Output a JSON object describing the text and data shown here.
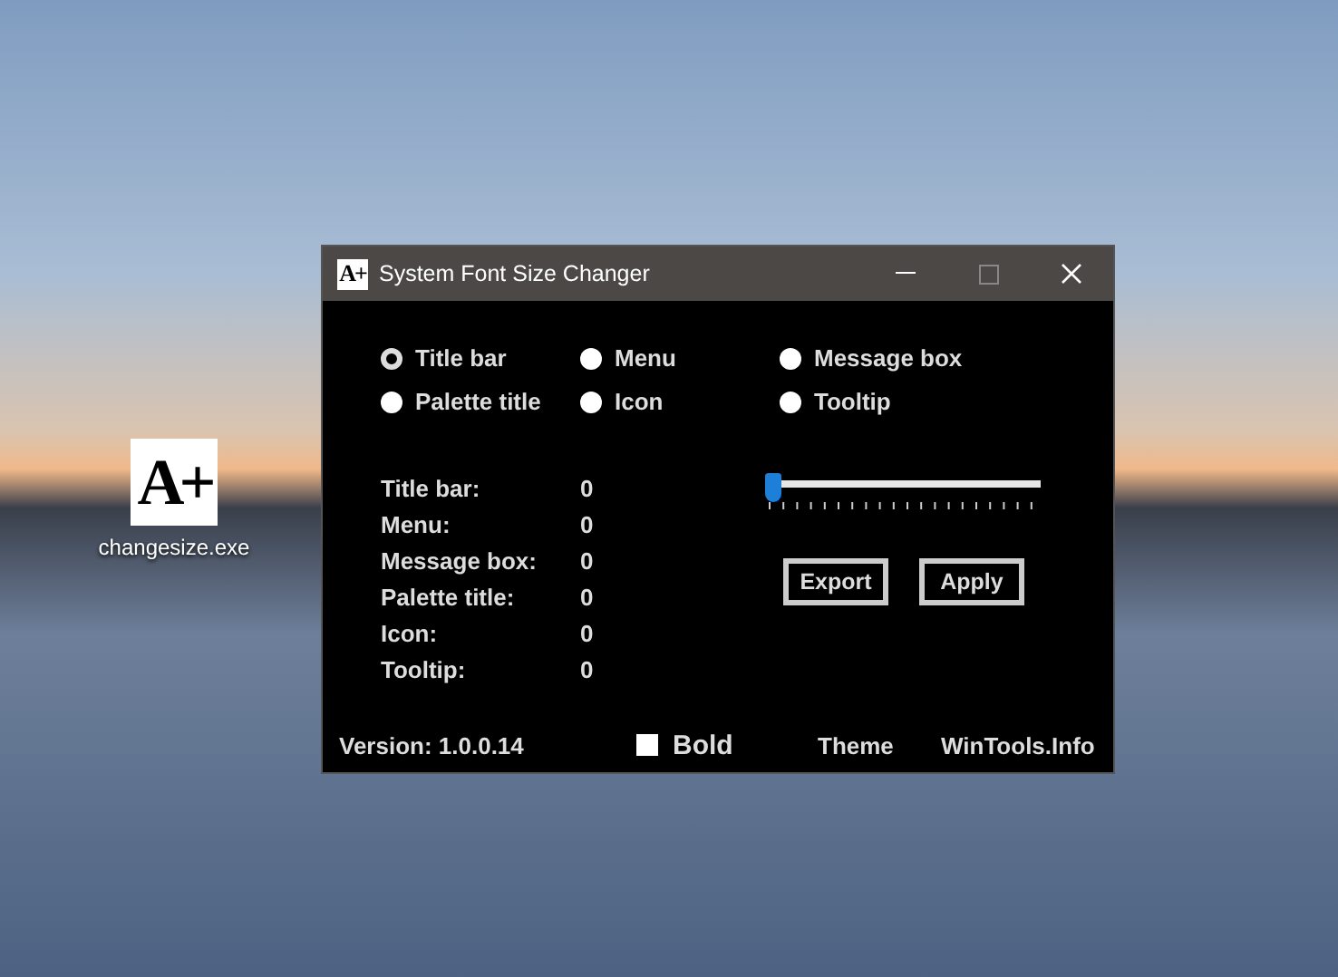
{
  "desktop_icon": {
    "logo": "A+",
    "label": "changesize.exe"
  },
  "window": {
    "logo": "A+",
    "title": "System Font Size Changer"
  },
  "radios": [
    {
      "label": "Title bar",
      "selected": true
    },
    {
      "label": "Menu",
      "selected": false
    },
    {
      "label": "Message box",
      "selected": false
    },
    {
      "label": "Palette title",
      "selected": false
    },
    {
      "label": "Icon",
      "selected": false
    },
    {
      "label": "Tooltip",
      "selected": false
    }
  ],
  "sizes": [
    {
      "label": "Title bar:",
      "value": "0"
    },
    {
      "label": "Menu:",
      "value": "0"
    },
    {
      "label": "Message box:",
      "value": "0"
    },
    {
      "label": "Palette title:",
      "value": "0"
    },
    {
      "label": "Icon:",
      "value": "0"
    },
    {
      "label": "Tooltip:",
      "value": "0"
    }
  ],
  "slider": {
    "level": 0
  },
  "buttons": [
    "Export",
    "Apply"
  ],
  "footer": {
    "version": "Version: 1.0.0.14",
    "bold": {
      "label": "Bold",
      "checked": false
    },
    "theme": "Theme",
    "link": "WinTools.Info"
  }
}
